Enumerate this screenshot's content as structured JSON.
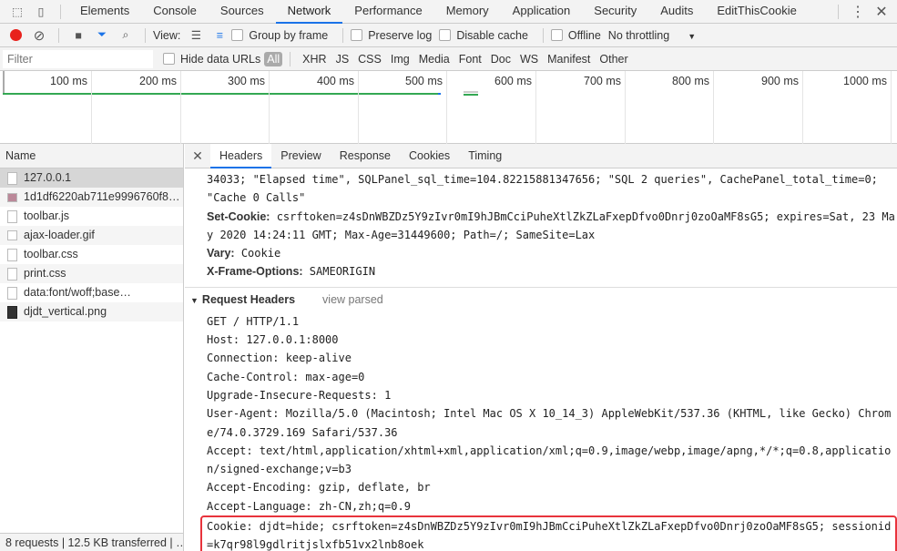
{
  "devtools": {
    "tabs": [
      "Elements",
      "Console",
      "Sources",
      "Network",
      "Performance",
      "Memory",
      "Application",
      "Security",
      "Audits",
      "EditThisCookie"
    ],
    "active_tab": "Network"
  },
  "toolbar": {
    "view_label": "View:",
    "group_by_frame": "Group by frame",
    "preserve_log": "Preserve log",
    "disable_cache": "Disable cache",
    "offline": "Offline",
    "throttling": "No throttling",
    "record_color": "#e8211c",
    "filter_color": "#1a73e8"
  },
  "filterbar": {
    "placeholder": "Filter",
    "hide_data_urls": "Hide data URLs",
    "types": [
      "All",
      "XHR",
      "JS",
      "CSS",
      "Img",
      "Media",
      "Font",
      "Doc",
      "WS",
      "Manifest",
      "Other"
    ],
    "active_type": "All"
  },
  "overview": {
    "ticks": [
      "100 ms",
      "200 ms",
      "300 ms",
      "400 ms",
      "500 ms",
      "600 ms",
      "700 ms",
      "800 ms",
      "900 ms",
      "1000 ms"
    ]
  },
  "requests": {
    "header": "Name",
    "items": [
      {
        "name": "127.0.0.1",
        "icon": "document-icon"
      },
      {
        "name": "1d1df6220ab711e9996760f8…",
        "icon": "image-icon"
      },
      {
        "name": "toolbar.js",
        "icon": "script-icon"
      },
      {
        "name": "ajax-loader.gif",
        "icon": "gif-icon"
      },
      {
        "name": "toolbar.css",
        "icon": "stylesheet-icon"
      },
      {
        "name": "print.css",
        "icon": "stylesheet-icon"
      },
      {
        "name": "data:font/woff;base…",
        "icon": "font-icon"
      },
      {
        "name": "djdt_vertical.png",
        "icon": "png-icon"
      }
    ],
    "status": "8 requests | 12.5 KB transferred | …"
  },
  "detail": {
    "tabs": [
      "Headers",
      "Preview",
      "Response",
      "Cookies",
      "Timing"
    ],
    "active_tab": "Headers",
    "response_tail": "34033; \"Elapsed time\", SQLPanel_sql_time=104.82215881347656; \"SQL 2 queries\", CachePanel_total_time=0; \"Cache 0 Calls\"",
    "response_headers": [
      {
        "name": "Set-Cookie:",
        "value": "csrftoken=z4sDnWBZDz5Y9zIvr0mI9hJBmCciPuheXtlZkZLaFxepDfvo0Dnrj0zoOaMF8sG5; expires=Sat, 23 May 2020 14:24:11 GMT; Max-Age=31449600; Path=/; SameSite=Lax"
      },
      {
        "name": "Vary:",
        "value": "Cookie"
      },
      {
        "name": "X-Frame-Options:",
        "value": "SAMEORIGIN"
      }
    ],
    "request_section": {
      "title": "Request Headers",
      "view_parsed": "view parsed"
    },
    "request_lines": [
      "GET / HTTP/1.1",
      "Host: 127.0.0.1:8000",
      "Connection: keep-alive",
      "Cache-Control: max-age=0",
      "Upgrade-Insecure-Requests: 1",
      "User-Agent: Mozilla/5.0 (Macintosh; Intel Mac OS X 10_14_3) AppleWebKit/537.36 (KHTML, like Gecko) Chrome/74.0.3729.169 Safari/537.36",
      "Accept: text/html,application/xhtml+xml,application/xml;q=0.9,image/webp,image/apng,*/*;q=0.8,application/signed-exchange;v=b3",
      "Accept-Encoding: gzip, deflate, br",
      "Accept-Language: zh-CN,zh;q=0.9"
    ],
    "cookie_line": "Cookie: djdt=hide; csrftoken=z4sDnWBZDz5Y9zIvr0mI9hJBmCciPuheXtlZkZLaFxepDfvo0Dnrj0zoOaMF8sG5; sessionid=k7qr98l9gdlritjslxfb51vx2lnb8oek",
    "highlight_color": "#e8333c"
  }
}
